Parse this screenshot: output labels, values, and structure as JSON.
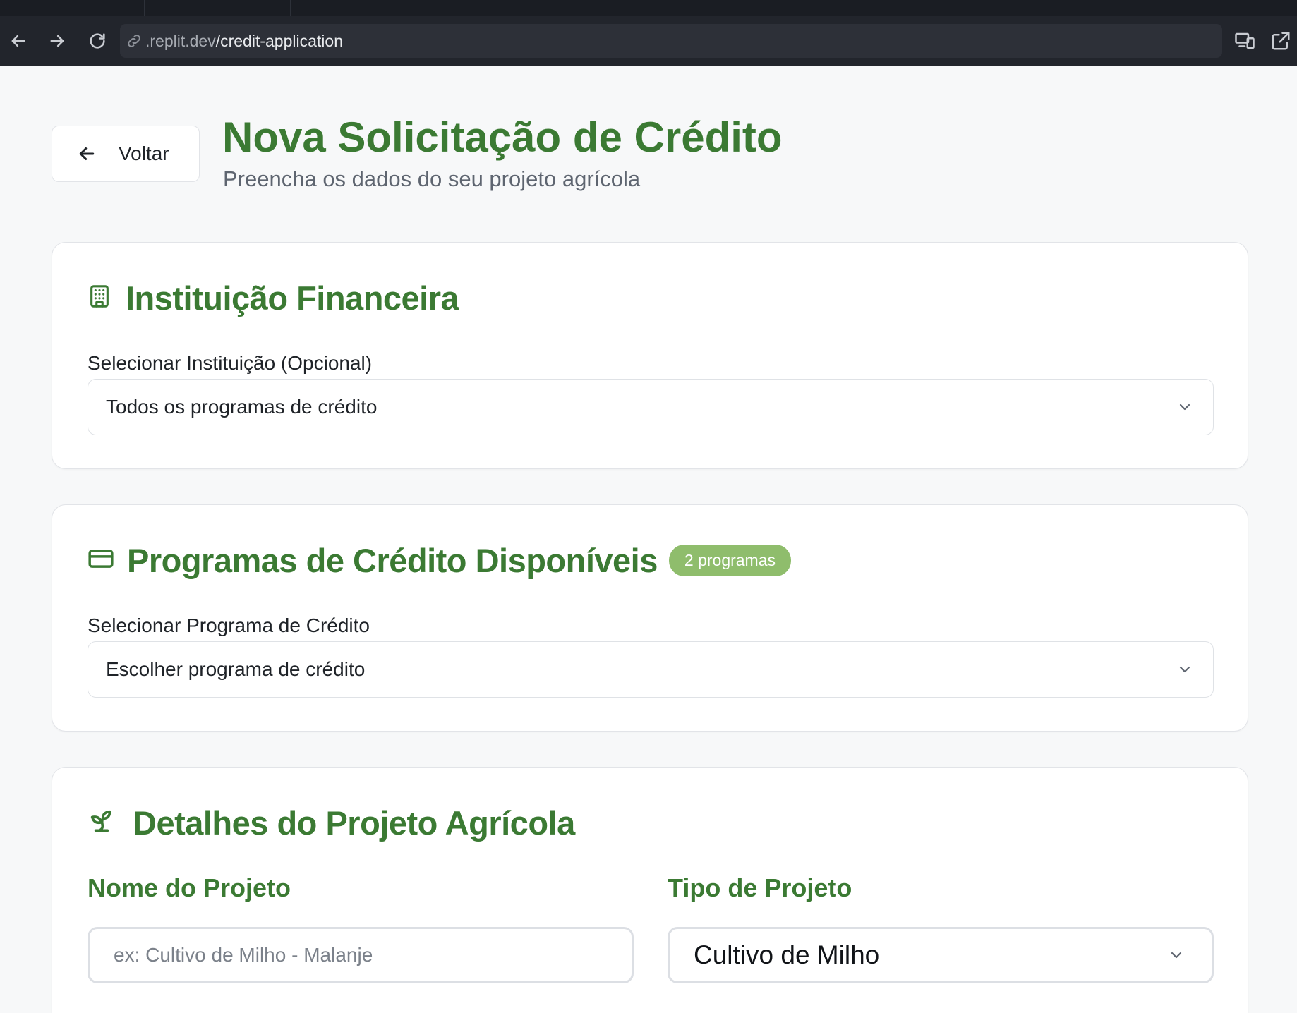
{
  "browser": {
    "url_prefix": ".replit.dev",
    "url_path": "/credit-application"
  },
  "header": {
    "back_label": "Voltar",
    "title": "Nova Solicitação de Crédito",
    "subtitle": "Preencha os dados do seu projeto agrícola"
  },
  "institution": {
    "title": "Instituição Financeira",
    "icon": "building-icon",
    "field_label": "Selecionar Instituição (Opcional)",
    "selected": "Todos os programas de crédito"
  },
  "programs": {
    "title": "Programas de Crédito Disponíveis",
    "icon": "credit-card-icon",
    "badge": "2 programas",
    "field_label": "Selecionar Programa de Crédito",
    "selected": "Escolher programa de crédito"
  },
  "project": {
    "title": "Detalhes do Projeto Agrícola",
    "icon": "sprout-icon",
    "name_label": "Nome do Projeto",
    "name_placeholder": "ex: Cultivo de Milho - Malanje",
    "type_label": "Tipo de Projeto",
    "type_selected": "Cultivo de Milho"
  },
  "colors": {
    "brand_green": "#3b7a33",
    "badge_green": "#8fbd6c",
    "chrome_dark": "#22252c"
  }
}
